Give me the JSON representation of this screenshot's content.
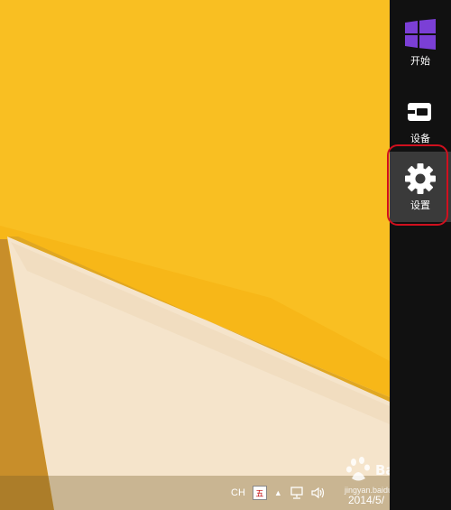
{
  "charms": [
    {
      "label": "开始",
      "icon": "windows-logo-icon"
    },
    {
      "label": "设备",
      "icon": "devices-icon"
    },
    {
      "label": "设置",
      "icon": "gear-icon"
    }
  ],
  "taskbar": {
    "language": "CH",
    "ime": "五",
    "clock": "2014/5/"
  },
  "watermark": {
    "brand": "Bai 经验",
    "url": "jingyan.baidu.com"
  },
  "colors": {
    "charms_bg": "#111111",
    "settings_highlight": "#3a3a3a",
    "ring": "#d0101e",
    "windows_logo": "#7b3fd6",
    "wallpaper_yellow": "#f5b51a",
    "wallpaper_cream": "#f6e6cf"
  }
}
